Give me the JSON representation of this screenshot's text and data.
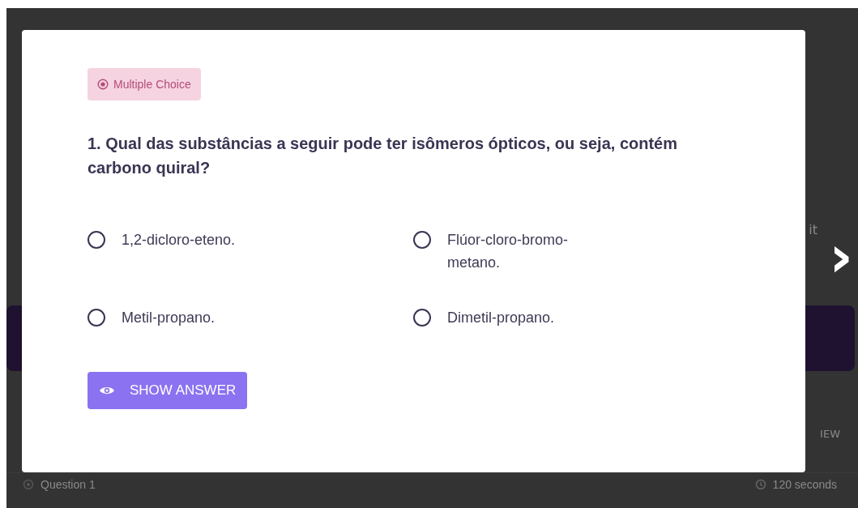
{
  "background": {
    "side_label": "it",
    "next_arrow": "›",
    "footer_link": "IEW",
    "question_row": {
      "label": "Question 1",
      "time": "120 seconds"
    }
  },
  "modal": {
    "badge": "Multiple Choice",
    "question": "1. Qual das substâncias a seguir pode ter isômeros ópticos, ou seja, contém carbono quiral?",
    "options": [
      {
        "label": "1,2-dicloro-eteno.",
        "selected": false
      },
      {
        "label": "Flúor-cloro-bromo-metano.",
        "selected": false
      },
      {
        "label": "Metil-propano.",
        "selected": false
      },
      {
        "label": "Dimetil-propano.",
        "selected": false
      }
    ],
    "button": "SHOW ANSWER"
  }
}
